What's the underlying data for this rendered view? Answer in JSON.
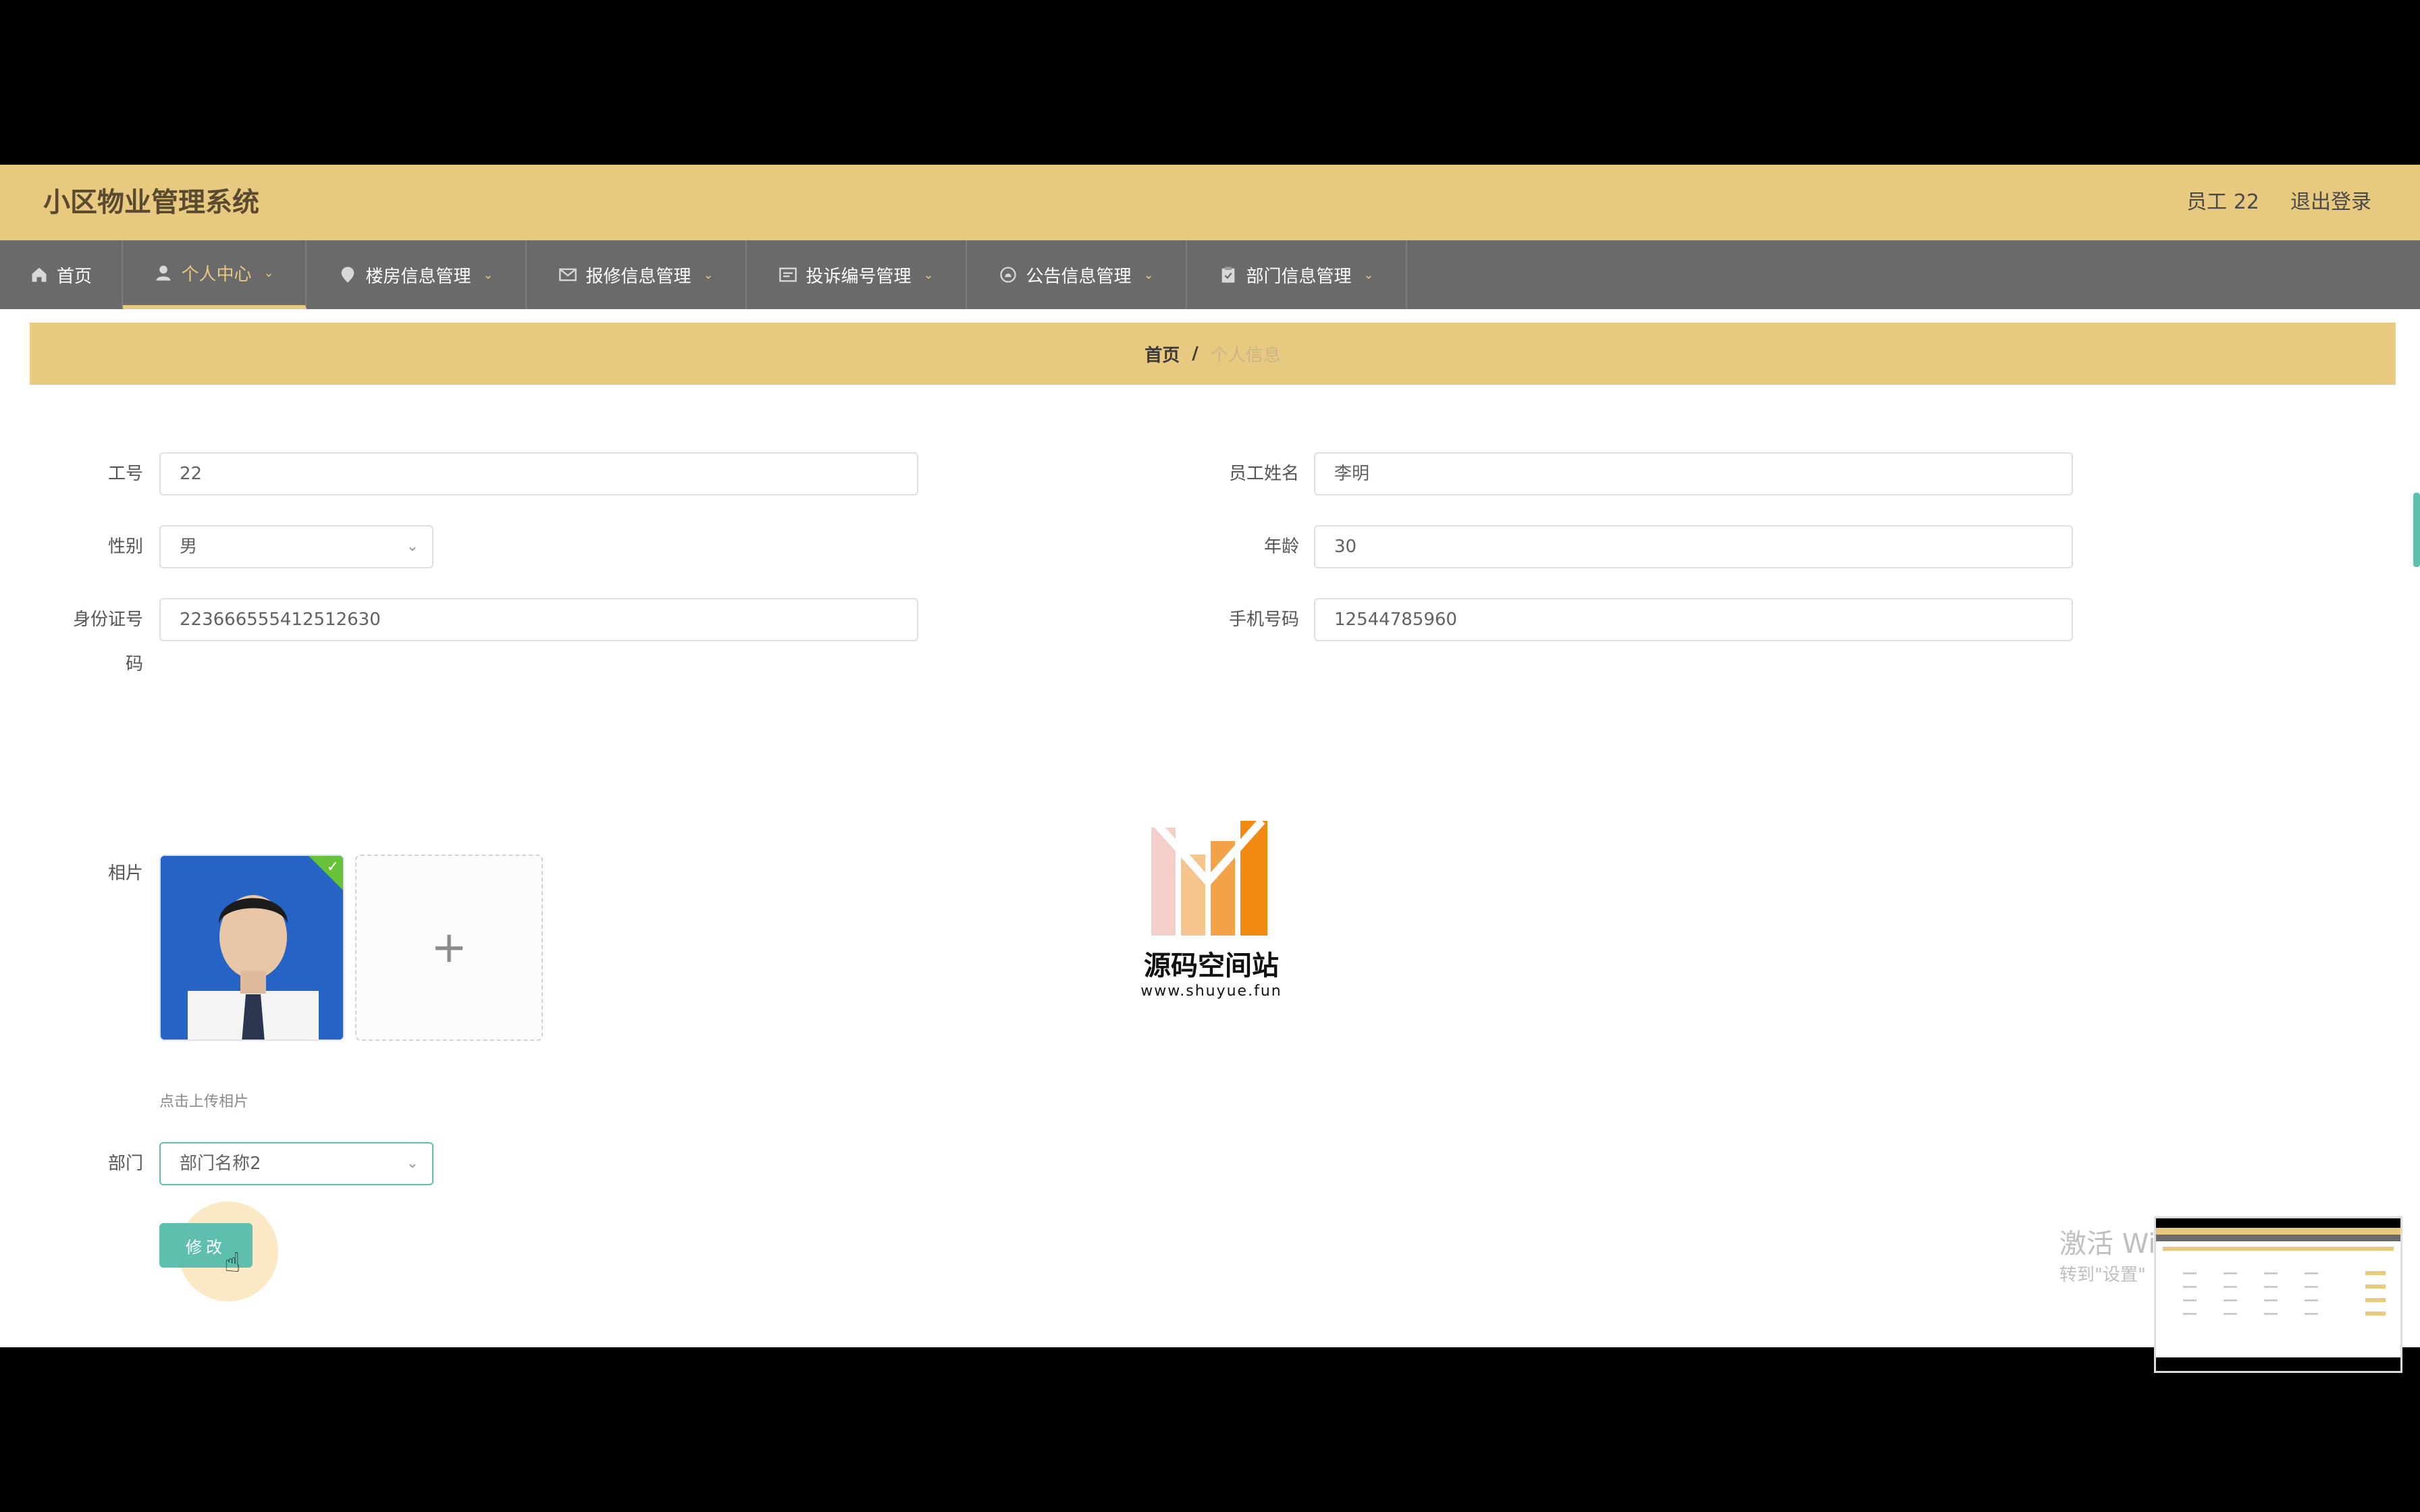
{
  "app": {
    "title": "小区物业管理系统"
  },
  "user": {
    "name": "员工 22",
    "logout": "退出登录"
  },
  "nav": [
    {
      "label": "首页",
      "icon": "home-icon"
    },
    {
      "label": "个人中心",
      "icon": "user-icon"
    },
    {
      "label": "楼房信息管理",
      "icon": "location-icon"
    },
    {
      "label": "报修信息管理",
      "icon": "mail-icon"
    },
    {
      "label": "投诉编号管理",
      "icon": "message-icon"
    },
    {
      "label": "公告信息管理",
      "icon": "bell-icon"
    },
    {
      "label": "部门信息管理",
      "icon": "clipboard-icon"
    }
  ],
  "breadcrumb": {
    "home": "首页",
    "separator": "/",
    "current": "个人信息"
  },
  "form": {
    "employee_id_label": "工号",
    "employee_id": "22",
    "name_label": "员工姓名",
    "name": "李明",
    "gender_label": "性别",
    "gender": "男",
    "age_label": "年龄",
    "age": "30",
    "idcard_label_1": "身份证号",
    "idcard_label_2": "码",
    "idcard": "223666555412512630",
    "phone_label": "手机号码",
    "phone": "12544785960",
    "photo_label": "相片",
    "upload_plus": "+",
    "upload_hint": "点击上传相片",
    "dept_label": "部门",
    "dept": "部门名称2",
    "submit": "修改"
  },
  "watermark": {
    "title": "源码空间站",
    "url": "www.shuyue.fun"
  },
  "windows": {
    "line1": "激活 Wi",
    "line2": "转到\"设置\""
  },
  "colors": {
    "header": "#e8c980",
    "nav": "#6a6a6a",
    "accent": "#5fbfae"
  }
}
